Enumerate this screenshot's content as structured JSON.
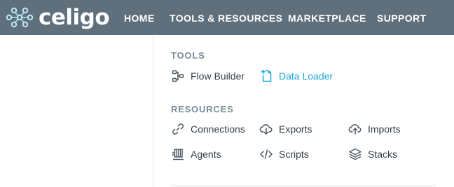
{
  "brand": {
    "name": "celigo"
  },
  "nav": {
    "home": "HOME",
    "tools_resources": "TOOLS & RESOURCES",
    "marketplace": "MARKETPLACE",
    "support": "SUPPORT"
  },
  "dropdown": {
    "tools_title": "TOOLS",
    "resources_title": "RESOURCES",
    "tools": [
      {
        "label": "Flow Builder",
        "icon": "flow-builder-icon"
      },
      {
        "label": "Data Loader",
        "icon": "data-loader-icon",
        "active": true
      }
    ],
    "resources": [
      {
        "label": "Connections",
        "icon": "link-icon"
      },
      {
        "label": "Exports",
        "icon": "cloud-download-icon"
      },
      {
        "label": "Imports",
        "icon": "cloud-upload-icon"
      },
      {
        "label": "Agents",
        "icon": "agent-icon"
      },
      {
        "label": "Scripts",
        "icon": "code-icon"
      },
      {
        "label": "Stacks",
        "icon": "layers-icon"
      }
    ]
  },
  "colors": {
    "header_bg": "#5f6f7c",
    "accent": "#1da7d9",
    "text": "#333e48",
    "section_title": "#7a8c99"
  }
}
